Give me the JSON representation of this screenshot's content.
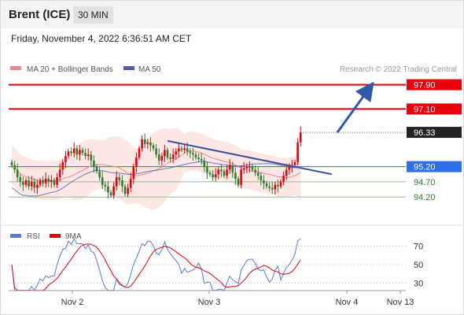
{
  "header": {
    "instrument": "Brent (ICE)",
    "timeframe": "30 MIN"
  },
  "datetime": "Friday, November 4, 2022 6:36:51 AM CET",
  "legend": {
    "item1": "MA 20 + Bollinger Bands",
    "item2": "MA 50",
    "copyright": "Research © 2022 Trading Central"
  },
  "rsi_legend": {
    "item1": "RSI",
    "item2": "9MA"
  },
  "colors": {
    "bb_fill": "#fde3e1",
    "ma20": "#e88a8a",
    "ma50": "#4a5fa8",
    "resistance": "#e8000b",
    "support": "#8fbc8f",
    "pivot": "#2f6ee6",
    "bull": "#e8000b",
    "bear": "#2e7d32",
    "trendline": "#3f4f9e",
    "rsi": "#5a7bd6",
    "rsi_ma": "#e8000b"
  },
  "chart_data": {
    "type": "line",
    "title": "Brent (ICE)",
    "ylim": [
      93.4,
      98.2
    ],
    "levels": [
      {
        "value": 97.9,
        "label": "97.90",
        "kind": "resistance"
      },
      {
        "value": 97.1,
        "label": "97.10",
        "kind": "resistance"
      },
      {
        "value": 96.33,
        "label": "96.33",
        "kind": "last"
      },
      {
        "value": 95.2,
        "label": "95.20",
        "kind": "pivot"
      },
      {
        "value": 94.7,
        "label": "94.70",
        "kind": "support"
      },
      {
        "value": 94.2,
        "label": "94.20",
        "kind": "support"
      }
    ],
    "x_ticks": [
      "Nov 2",
      "Nov 3",
      "Nov 4",
      "Nov 13"
    ],
    "series": [
      {
        "values": [
          95.25,
          95.1,
          94.85,
          94.7,
          94.6,
          94.75,
          94.55,
          94.7,
          94.5,
          94.6,
          94.75,
          94.65,
          94.8,
          94.7,
          94.75,
          94.6,
          94.85,
          95.1,
          95.35,
          95.55,
          95.7,
          95.65,
          95.8,
          95.6,
          95.75,
          95.65,
          95.55,
          95.6,
          95.4,
          95.2,
          95.05,
          94.85,
          94.6,
          94.55,
          94.35,
          94.25,
          94.55,
          94.85,
          94.75,
          94.55,
          94.3,
          94.5,
          94.8,
          95.2,
          95.5,
          95.8,
          96.1,
          95.95,
          96.0,
          95.9,
          95.8,
          95.6,
          95.4,
          95.55,
          95.75,
          95.5,
          95.45,
          95.6,
          95.7,
          95.8,
          95.75,
          95.8,
          95.7,
          95.65,
          95.6,
          95.5,
          95.45,
          95.4,
          95.2,
          95.0,
          94.95,
          94.85,
          94.95,
          95.1,
          95.05,
          94.9,
          95.1,
          95.25,
          95.0,
          94.8,
          94.6,
          95.1,
          95.15,
          95.2,
          95.2,
          95.1,
          95.0,
          94.9,
          94.75,
          94.65,
          94.55,
          94.5,
          94.45,
          94.6,
          94.55,
          94.7,
          94.9,
          95.1,
          95.2,
          95.25,
          95.35,
          96.0,
          96.33
        ]
      },
      {
        "name": "MA 20 + Bollinger Bands",
        "band": true
      },
      {
        "name": "MA 50"
      }
    ],
    "trendlines": [
      {
        "from": {
          "i": 55,
          "y": 96.05
        },
        "to": {
          "i": 113,
          "y": 94.95
        }
      },
      {
        "from": {
          "i": 115,
          "y": 96.33
        },
        "to": {
          "i": 126,
          "y": 97.75
        },
        "arrow": true
      }
    ],
    "rsi": {
      "ylim": [
        20,
        80
      ],
      "ticks": [
        70,
        50,
        30
      ],
      "series": [
        {
          "name": "RSI"
        },
        {
          "name": "9MA"
        }
      ]
    }
  }
}
